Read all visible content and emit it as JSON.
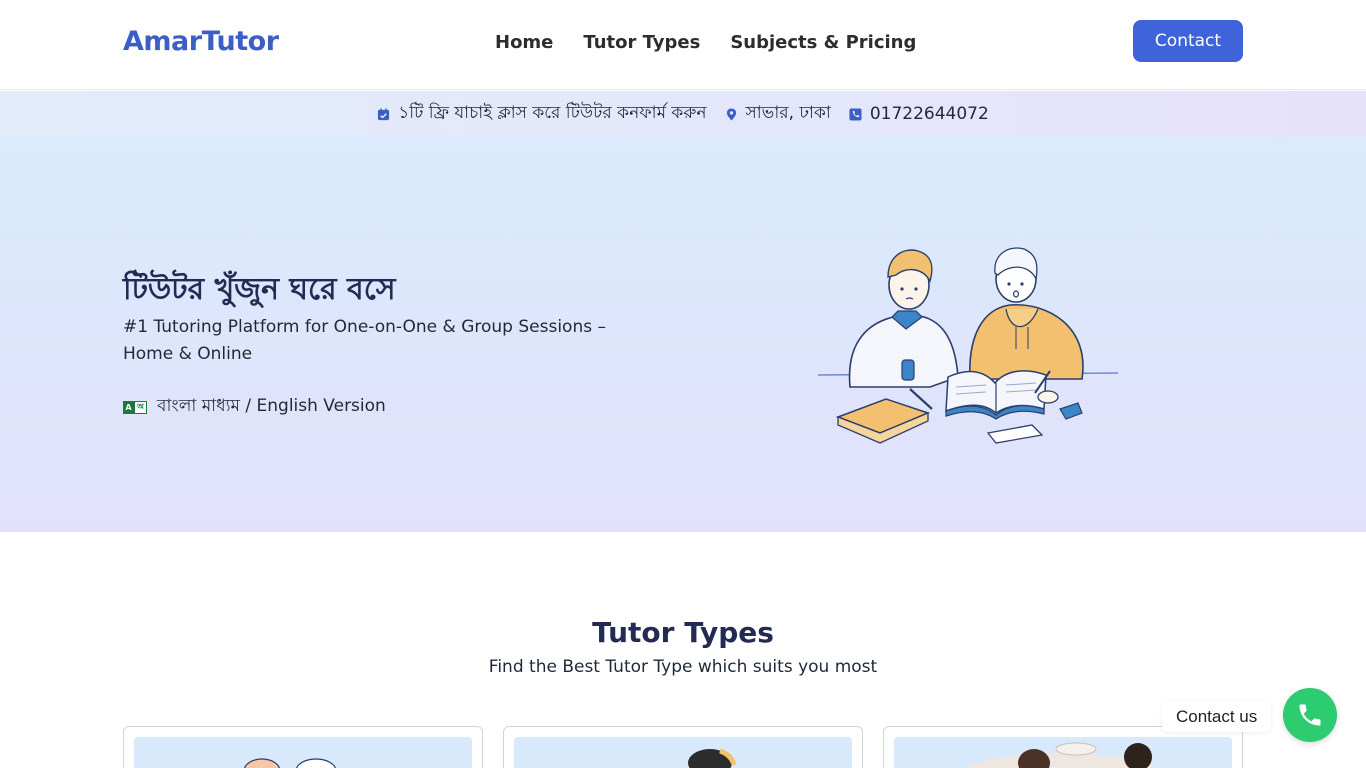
{
  "header": {
    "logo": "AmarTutor",
    "nav": [
      "Home",
      "Tutor Types",
      "Subjects & Pricing"
    ],
    "contact_label": "Contact"
  },
  "infobar": {
    "free_class": "১টি ফ্রি যাচাই ক্লাস করে টিউটর কনফার্ম করুন",
    "location": "সাভার, ঢাকা",
    "phone": "01722644072",
    "icons": [
      "calendar-check-icon",
      "map-pin-icon",
      "phone-icon"
    ]
  },
  "hero": {
    "title": "টিউটর খুঁজুন ঘরে বসে",
    "subtitle": "#1 Tutoring Platform for One-on-One & Group Sessions – Home & Online",
    "language": "বাংলা মাধ্যম / English Version",
    "lang_icon_text": [
      "A",
      "অ"
    ]
  },
  "tutor_types": {
    "title": "Tutor Types",
    "subtitle": "Find the Best Tutor Type which suits you most"
  },
  "floating": {
    "label": "Contact us"
  },
  "colors": {
    "brand": "#3b5fc7",
    "button": "#3f63d9",
    "whatsapp": "#2ecc71",
    "heading": "#232a54"
  }
}
